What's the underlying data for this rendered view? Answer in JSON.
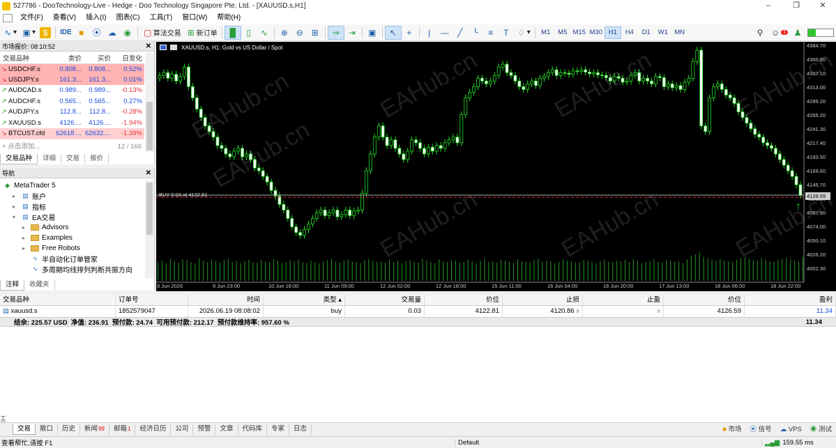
{
  "window": {
    "title": "527786 - DooTechnology-Live - Hedge - Doo Technology Singapore Pte. Ltd. - [XAUUSD.s,H1]"
  },
  "menu": [
    "文件(F)",
    "查看(V)",
    "插入(I)",
    "图表(C)",
    "工具(T)",
    "窗口(W)",
    "帮助(H)"
  ],
  "toolbar": {
    "algo": "算法交易",
    "new_order": "新订单",
    "ide": "IDE",
    "timeframes": [
      "M1",
      "M5",
      "M15",
      "M30",
      "H1",
      "H4",
      "D1",
      "W1",
      "MN"
    ],
    "active_tf": "H1",
    "alert_count": "1"
  },
  "market_watch": {
    "header": "市场报价: 08:10:52",
    "columns": [
      "交易品种",
      "卖价",
      "买价",
      "日变化"
    ],
    "rows": [
      {
        "symbol": "USDCHF.s",
        "bid": "0.808...",
        "ask": "0.808...",
        "change": "0.52%",
        "dir": "down",
        "bg": "#ffb3b3",
        "change_color": "#1a4de0"
      },
      {
        "symbol": "USDJPY.s",
        "bid": "161.3...",
        "ask": "161.3...",
        "change": "0.01%",
        "dir": "down",
        "bg": "#ffb3b3",
        "change_color": "#1a4de0"
      },
      {
        "symbol": "AUDCAD.s",
        "bid": "0.989...",
        "ask": "0.989...",
        "change": "-0.13%",
        "dir": "up",
        "bg": "#ffffff",
        "change_color": "#e03030"
      },
      {
        "symbol": "AUDCHF.s",
        "bid": "0.565...",
        "ask": "0.565...",
        "change": "0.27%",
        "dir": "up",
        "bg": "#ffffff",
        "change_color": "#1a4de0"
      },
      {
        "symbol": "AUDJPY.s",
        "bid": "112.8...",
        "ask": "112.8...",
        "change": "-0.28%",
        "dir": "up",
        "bg": "#ffffff",
        "change_color": "#e03030"
      },
      {
        "symbol": "XAUUSD.s",
        "bid": "4126....",
        "ask": "4126....",
        "change": "-1.94%",
        "dir": "up",
        "bg": "#ffffff",
        "change_color": "#e03030"
      },
      {
        "symbol": "BTCUST.cfd",
        "bid": "62618....",
        "ask": "62632....",
        "change": "-1.39%",
        "dir": "down",
        "bg": "#ffd0d0",
        "change_color": "#e03030"
      }
    ],
    "add_label": "点击添加...",
    "count": "12 / 166",
    "tabs": [
      "交易品种",
      "详细",
      "交易",
      "报价"
    ]
  },
  "navigator": {
    "header": "导航",
    "items": [
      {
        "label": "MetaTrader 5",
        "level": 0,
        "kind": "root"
      },
      {
        "label": "账户",
        "level": 1,
        "kind": "item"
      },
      {
        "label": "指标",
        "level": 1,
        "kind": "item"
      },
      {
        "label": "EA交易",
        "level": 1,
        "kind": "item"
      },
      {
        "label": "Advisors",
        "level": 2,
        "kind": "folder"
      },
      {
        "label": "Examples",
        "level": 2,
        "kind": "folder"
      },
      {
        "label": "Free Robots",
        "level": 2,
        "kind": "folder"
      },
      {
        "label": "半自动化订单管家",
        "level": 2,
        "kind": "ea"
      },
      {
        "label": "多周期均线排列判断共振方向",
        "level": 2,
        "kind": "ea"
      }
    ],
    "tabs": [
      "注释",
      "收藏夹"
    ]
  },
  "chart": {
    "title": "XAUUSD.s, H1:  Gold vs US Dollar / Spot",
    "trade_label": "BUY 0.03 at 4122.81",
    "price_label": "4126.59",
    "y_ticks": [
      "4384.70",
      "4360.90",
      "4337.10",
      "4313.00",
      "4289.20",
      "4265.20",
      "4241.30",
      "4217.40",
      "4193.50",
      "4169.60",
      "4145.70",
      "4121.80",
      "4097.90",
      "4074.00",
      "4050.10",
      "4026.20",
      "4002.30"
    ],
    "x_ticks": [
      "9 Jun 2026",
      "9 Jun 23:00",
      "10 Jun 16:00",
      "11 Jun 09:00",
      "12 Jun 02:00",
      "12 Jun 18:00",
      "15 Jun 11:00",
      "16 Jun 04:00",
      "16 Jun 20:00",
      "17 Jun 13:00",
      "18 Jun 06:00",
      "18 Jun 22:00"
    ],
    "watermark": "EAHub.cn"
  },
  "chart_data": {
    "type": "candlestick",
    "title": "XAUUSD.s, H1:  Gold vs US Dollar / Spot",
    "xlabel": "",
    "ylabel": "",
    "ylim": [
      3990,
      4390
    ],
    "close": [
      4340,
      4345,
      4335,
      4342,
      4330,
      4338,
      4355,
      4320,
      4300,
      4280,
      4265,
      4250,
      4240,
      4230,
      4215,
      4210,
      4200,
      4195,
      4205,
      4210,
      4195,
      4200,
      4190,
      4175,
      4170,
      4160,
      4150,
      4135,
      4125,
      4110,
      4100,
      4085,
      4070,
      4060,
      4055,
      4065,
      4075,
      4085,
      4095,
      4100,
      4090,
      4095,
      4100,
      4088,
      4092,
      4100,
      4090,
      4098,
      4100,
      4130,
      4170,
      4200,
      4230,
      4250,
      4230,
      4215,
      4225,
      4210,
      4200,
      4190,
      4205,
      4225,
      4220,
      4210,
      4200,
      4212,
      4205,
      4215,
      4210,
      4220,
      4225,
      4230,
      4220,
      4270,
      4300,
      4310,
      4320,
      4335,
      4330,
      4325,
      4330,
      4340,
      4355,
      4360,
      4345,
      4340,
      4330,
      4320,
      4315,
      4325,
      4330,
      4322,
      4335,
      4338,
      4345,
      4350,
      4340,
      4345,
      4344,
      4342,
      4348,
      4347,
      4350,
      4346,
      4343,
      4345,
      4341,
      4340,
      4336,
      4330,
      4338,
      4335,
      4328,
      4330,
      4340,
      4345,
      4330,
      4335,
      4330,
      4325,
      4338,
      4336,
      4320,
      4325,
      4318,
      4322,
      4315,
      4328,
      4335,
      4365,
      4385,
      4250,
      4240,
      4300,
      4320,
      4325,
      4315,
      4305,
      4300,
      4290,
      4275,
      4265,
      4255,
      4245,
      4235,
      4230,
      4220,
      4215,
      4210,
      4200,
      4190,
      4180,
      4170,
      4160,
      4145,
      4126
    ],
    "volume": [
      30,
      32,
      28,
      35,
      31,
      29,
      34,
      33,
      30,
      28,
      36,
      32,
      30,
      34,
      31,
      29,
      33,
      35,
      30,
      32,
      28,
      31,
      34,
      30,
      29,
      33,
      31,
      30,
      35,
      32,
      28,
      30,
      33,
      31,
      34,
      30,
      29,
      32,
      30,
      28,
      31,
      33,
      35,
      30,
      29,
      32,
      34,
      31,
      30,
      28,
      33,
      35,
      32,
      30,
      31,
      29,
      34,
      30,
      32,
      28,
      31,
      33,
      30,
      29,
      35,
      32,
      30,
      28,
      34,
      31,
      30,
      33,
      32,
      29,
      30,
      34,
      31,
      28,
      32,
      35,
      30,
      31,
      29,
      33,
      32,
      30,
      28,
      34,
      31,
      30,
      29,
      33,
      35,
      30,
      32,
      31,
      28,
      30,
      34,
      32,
      31,
      29,
      30,
      33,
      32,
      30,
      28,
      31,
      34,
      30,
      29,
      32,
      31,
      33,
      30,
      35,
      32,
      28,
      30,
      31,
      34,
      30,
      29,
      33,
      32,
      30,
      31,
      28,
      34,
      40,
      42,
      45,
      38,
      36,
      34,
      32,
      35,
      33,
      31,
      30,
      34,
      36,
      38,
      35,
      33,
      32,
      36,
      34,
      31,
      30,
      33,
      35,
      37,
      34,
      32,
      30,
      38
    ]
  },
  "trade": {
    "columns": [
      "交易品种",
      "订单号",
      "时间",
      "类型",
      "交易量",
      "价位",
      "止损",
      "止盈",
      "价位",
      "盈利"
    ],
    "row": {
      "symbol": "xauusd.s",
      "ticket": "1852579047",
      "time": "2026.06.19 08:08:02",
      "type": "buy",
      "volume": "0.03",
      "price": "4122.81",
      "sl": "4120.86",
      "sl_x": "x",
      "tp": "",
      "tp_x": "x",
      "cur_price": "4126.59",
      "profit": "11.34"
    },
    "summary": "结余: 225.57 USD  净值: 236.91  预付款: 24.74  可用预付款: 212.17  预付款维持率: 957.60 %",
    "total": "11.34"
  },
  "bottom_tabs": [
    {
      "label": "交易",
      "badge": ""
    },
    {
      "label": "敞口",
      "badge": ""
    },
    {
      "label": "历史",
      "badge": ""
    },
    {
      "label": "新闻",
      "badge": "99"
    },
    {
      "label": "邮箱",
      "badge": "1"
    },
    {
      "label": "经济日历",
      "badge": ""
    },
    {
      "label": "公司",
      "badge": ""
    },
    {
      "label": "预警",
      "badge": ""
    },
    {
      "label": "文章",
      "badge": ""
    },
    {
      "label": "代码库",
      "badge": ""
    },
    {
      "label": "专家",
      "badge": ""
    },
    {
      "label": "日志",
      "badge": ""
    }
  ],
  "right_status": [
    "市场",
    "信号",
    "VPS",
    "测试"
  ],
  "toolbox_label": "工具箱",
  "status": {
    "help": "查看帮忙,请按 F1",
    "profile": "Default",
    "ping": "159.55 ms"
  }
}
